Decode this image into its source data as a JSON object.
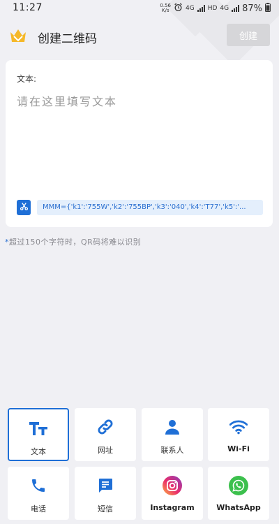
{
  "status_bar": {
    "time": "11:27",
    "net_speed_value": "0.56",
    "net_speed_unit": "K/s",
    "network_1": "4G",
    "hd_badge": "HD",
    "network_2": "4G",
    "battery": "87%"
  },
  "header": {
    "title": "创建二维码",
    "create_label": "创建"
  },
  "text_input": {
    "label": "文本:",
    "placeholder": "请在这里填写文本",
    "clipboard_preview": "MMM={'k1':'755W','k2':'755BP','k3':'040','k4':'T77','k5':'..."
  },
  "hint": {
    "star": "*",
    "text": "超过150个字符时，QR码将难以识别"
  },
  "types": [
    {
      "label": "文本",
      "icon": "text-format-icon",
      "selected": true
    },
    {
      "label": "网址",
      "icon": "link-icon",
      "selected": false
    },
    {
      "label": "联系人",
      "icon": "person-icon",
      "selected": false
    },
    {
      "label": "Wi-Fi",
      "icon": "wifi-icon",
      "selected": false
    },
    {
      "label": "电话",
      "icon": "phone-icon",
      "selected": false
    },
    {
      "label": "短信",
      "icon": "message-icon",
      "selected": false
    },
    {
      "label": "Instagram",
      "icon": "instagram-icon",
      "selected": false
    },
    {
      "label": "WhatsApp",
      "icon": "whatsapp-icon",
      "selected": false
    }
  ],
  "colors": {
    "accent": "#1f6fd6",
    "background": "#f0f0f4",
    "disabled_button": "#d6d6d9"
  }
}
